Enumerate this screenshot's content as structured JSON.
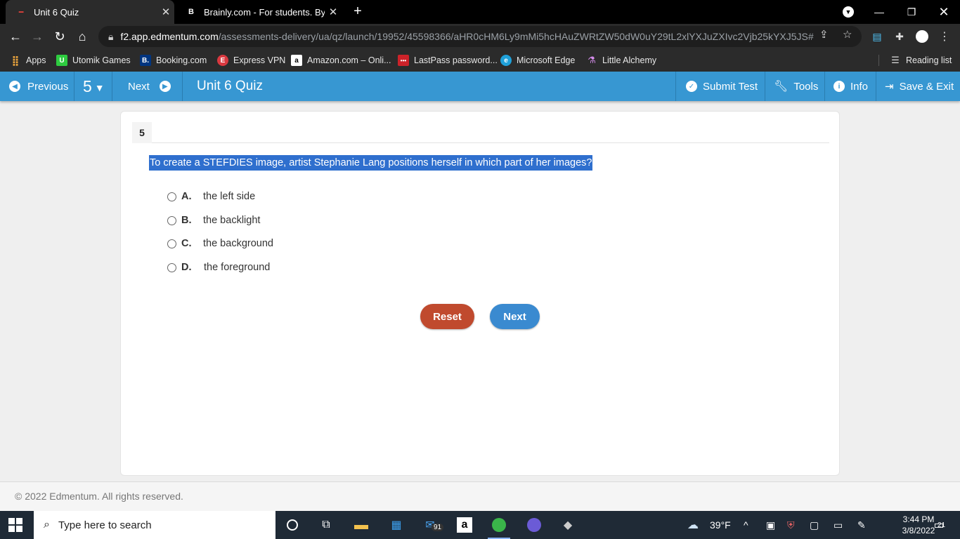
{
  "browser": {
    "tabs": [
      {
        "title": "Unit 6 Quiz",
        "active": true,
        "favicon": "E"
      },
      {
        "title": "Brainly.com - For students. By stu",
        "active": false,
        "favicon": "B"
      }
    ],
    "url_host": "f2.app.edmentum.com",
    "url_path": "/assessments-delivery/ua/qz/launch/19952/45598366/aHR0cHM6Ly9mMi5hcHAuZWRtZW50dW0uY29tL2xlYXJuZXIvc2Vjb25kYXJ5JS#",
    "bookmarks": [
      {
        "label": "Apps",
        "icon": "apps-grid-icon"
      },
      {
        "label": "Utomik Games",
        "icon": "U"
      },
      {
        "label": "Booking.com",
        "icon": "B."
      },
      {
        "label": "Express VPN",
        "icon": "E"
      },
      {
        "label": "Amazon.com – Onli...",
        "icon": "a"
      },
      {
        "label": "LastPass password...",
        "icon": "•••"
      },
      {
        "label": "Microsoft Edge",
        "icon": "e"
      },
      {
        "label": "Little Alchemy",
        "icon": "A"
      }
    ],
    "reading_list": "Reading list"
  },
  "header": {
    "previous": "Previous",
    "question_number": "5",
    "next": "Next",
    "quiz_title": "Unit 6 Quiz",
    "submit": "Submit Test",
    "tools": "Tools",
    "info": "Info",
    "save_exit": "Save & Exit",
    "color": "#3797d2"
  },
  "question": {
    "number": "5",
    "prompt": "To create a STEFDIES image, artist Stephanie Lang positions herself in which part of her images?",
    "choices": [
      {
        "letter": "A.",
        "text": "the left side"
      },
      {
        "letter": "B.",
        "text": "the backlight"
      },
      {
        "letter": "C.",
        "text": "the background"
      },
      {
        "letter": "D.",
        "text": "the foreground"
      }
    ],
    "reset_label": "Reset",
    "next_label": "Next"
  },
  "footer": {
    "copyright": "© 2022 Edmentum. All rights reserved."
  },
  "taskbar": {
    "search_placeholder": "Type here to search",
    "mail_badge": "91",
    "weather": "39°F",
    "time": "3:44 PM",
    "date": "3/8/2022",
    "notification_count": "21"
  }
}
